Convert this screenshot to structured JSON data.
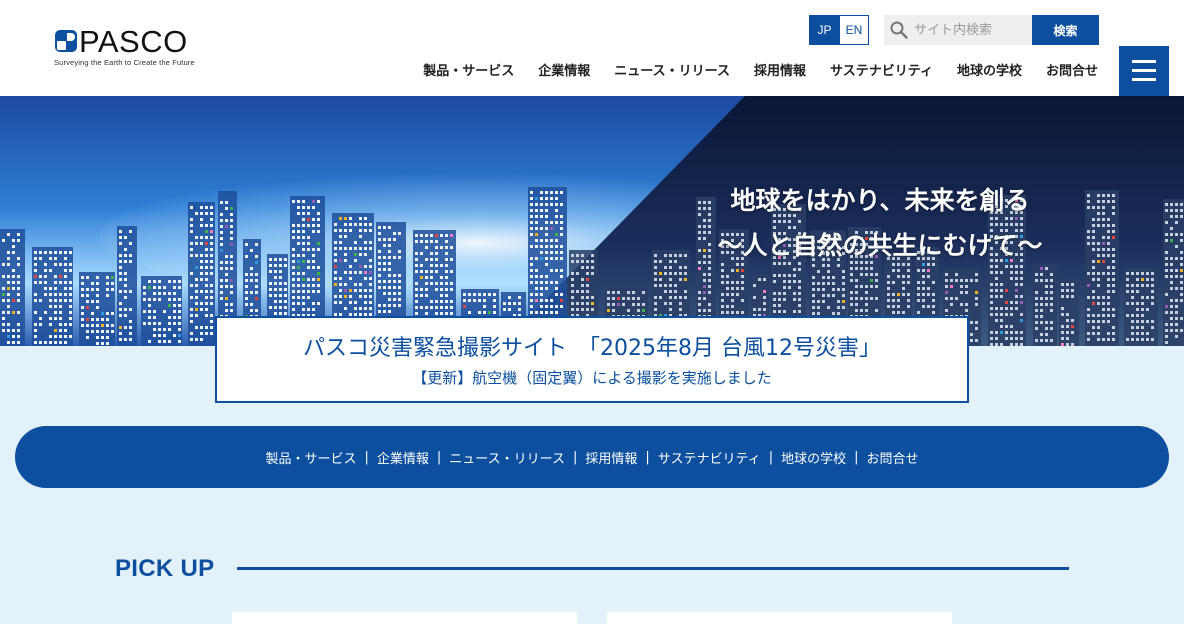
{
  "brand": {
    "name": "PASCO",
    "tagline": "Surveying the Earth to Create the Future"
  },
  "header": {
    "lang_jp": "JP",
    "lang_en": "EN",
    "search_placeholder": "サイト内検索",
    "search_button": "検索",
    "nav": [
      {
        "label": "製品・サービス"
      },
      {
        "label": "企業情報"
      },
      {
        "label": "ニュース・リリース"
      },
      {
        "label": "採用情報"
      },
      {
        "label": "サステナビリティ"
      },
      {
        "label": "地球の学校"
      },
      {
        "label": "お問合せ"
      }
    ],
    "menu_icon": "hamburger-icon"
  },
  "hero": {
    "line1": "地球をはかり、未来を創る",
    "line2": "～人と自然の共生にむけて～"
  },
  "notice": {
    "title": "パスコ災害緊急撮影サイト　「2025年8月 台風12号災害」",
    "subtitle": "【更新】航空機（固定翼）による撮影を実施しました"
  },
  "subnav": [
    {
      "label": "製品・サービス"
    },
    {
      "label": "企業情報"
    },
    {
      "label": "ニュース・リリース"
    },
    {
      "label": "採用情報"
    },
    {
      "label": "サステナビリティ"
    },
    {
      "label": "地球の学校"
    },
    {
      "label": "お問合せ"
    }
  ],
  "pickup": {
    "title": "PICK UP"
  },
  "colors": {
    "brand_blue": "#0b4f9e",
    "page_bg": "#e3f1fb"
  }
}
